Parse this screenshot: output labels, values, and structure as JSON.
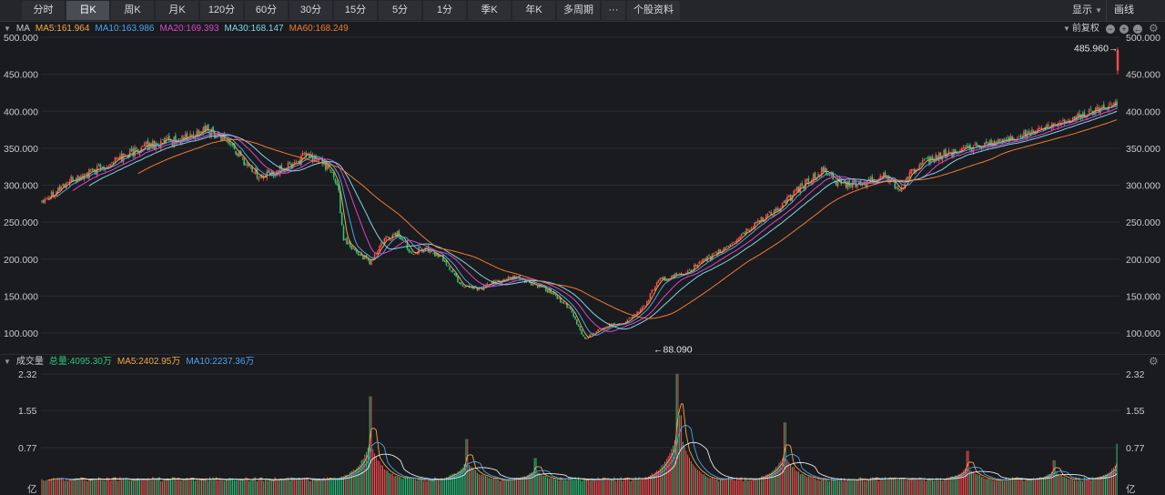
{
  "toolbar": {
    "tabs": [
      {
        "label": "分时",
        "active": false
      },
      {
        "label": "日K",
        "active": true
      },
      {
        "label": "周K",
        "active": false
      },
      {
        "label": "月K",
        "active": false
      },
      {
        "label": "120分",
        "active": false
      },
      {
        "label": "60分",
        "active": false
      },
      {
        "label": "30分",
        "active": false
      },
      {
        "label": "15分",
        "active": false
      },
      {
        "label": "5分",
        "active": false
      },
      {
        "label": "1分",
        "active": false
      },
      {
        "label": "季K",
        "active": false
      },
      {
        "label": "年K",
        "active": false
      },
      {
        "label": "多周期",
        "active": false
      },
      {
        "label": "···",
        "active": false
      },
      {
        "label": "个股资料",
        "active": false
      }
    ],
    "display_label": "显示",
    "draw_label": "画线"
  },
  "price_legend": {
    "indicator": "MA",
    "ma5": "MA5:161.964",
    "ma10": "MA10:163.986",
    "ma20": "MA20:169.393",
    "ma30": "MA30:168.147",
    "ma60": "MA60:168.249",
    "adjust_label": "前复权"
  },
  "volume_legend": {
    "indicator": "成交量",
    "total": "总量:4095.30万",
    "ma5": "MA5:2402.95万",
    "ma10": "MA10:2237.36万"
  },
  "colors": {
    "up": "#ff4d4f",
    "down": "#29c67a",
    "ma5": "#f0a848",
    "ma10": "#4aa3f0",
    "ma20": "#d946c7",
    "ma30": "#7ad6e8",
    "ma60": "#f07a30"
  },
  "chart_data": [
    {
      "type": "candlestick",
      "title": "",
      "ylim": [
        75,
        510
      ],
      "y_ticks": [
        "500.000",
        "450.000",
        "400.000",
        "350.000",
        "300.000",
        "250.000",
        "200.000",
        "150.000",
        "100.000"
      ],
      "trend_points": [
        [
          0,
          280
        ],
        [
          0.03,
          305
        ],
        [
          0.06,
          320
        ],
        [
          0.09,
          340
        ],
        [
          0.12,
          355
        ],
        [
          0.15,
          360
        ],
        [
          0.18,
          375
        ],
        [
          0.2,
          365
        ],
        [
          0.22,
          335
        ],
        [
          0.24,
          310
        ],
        [
          0.27,
          325
        ],
        [
          0.29,
          340
        ],
        [
          0.31,
          330
        ],
        [
          0.325,
          300
        ],
        [
          0.33,
          230
        ],
        [
          0.345,
          210
        ],
        [
          0.36,
          195
        ],
        [
          0.375,
          225
        ],
        [
          0.39,
          235
        ],
        [
          0.405,
          210
        ],
        [
          0.42,
          215
        ],
        [
          0.44,
          200
        ],
        [
          0.46,
          165
        ],
        [
          0.48,
          160
        ],
        [
          0.5,
          170
        ],
        [
          0.52,
          175
        ],
        [
          0.54,
          165
        ],
        [
          0.56,
          155
        ],
        [
          0.58,
          130
        ],
        [
          0.595,
          92
        ],
        [
          0.605,
          100
        ],
        [
          0.62,
          110
        ],
        [
          0.64,
          115
        ],
        [
          0.66,
          135
        ],
        [
          0.675,
          170
        ],
        [
          0.69,
          175
        ],
        [
          0.71,
          185
        ],
        [
          0.73,
          200
        ],
        [
          0.75,
          215
        ],
        [
          0.77,
          235
        ],
        [
          0.79,
          255
        ],
        [
          0.81,
          270
        ],
        [
          0.83,
          295
        ],
        [
          0.85,
          315
        ],
        [
          0.86,
          320
        ],
        [
          0.875,
          300
        ],
        [
          0.89,
          300
        ],
        [
          0.91,
          305
        ],
        [
          0.925,
          315
        ],
        [
          0.94,
          295
        ],
        [
          0.955,
          320
        ],
        [
          0.97,
          330
        ],
        [
          0.985,
          340
        ],
        [
          1.0,
          345
        ]
      ],
      "tail_points": [
        [
          0,
          345
        ],
        [
          0.3,
          360
        ],
        [
          0.6,
          380
        ],
        [
          0.85,
          400
        ],
        [
          1.0,
          412
        ]
      ],
      "last_candle": {
        "open": 455,
        "close": 483,
        "high": 486,
        "low": 450
      },
      "max_annotation": "485.960→",
      "min_annotation": "←88.090",
      "max_value": 485.96,
      "min_value": 88.09
    },
    {
      "type": "bar",
      "title": "",
      "ylim": [
        0,
        2.32
      ],
      "y_ticks": [
        "2.32",
        "1.55",
        "0.77"
      ],
      "unit_label": "亿",
      "spikes": [
        {
          "x": 0.305,
          "v": 1.85
        },
        {
          "x": 0.395,
          "v": 0.95
        },
        {
          "x": 0.458,
          "v": 0.55
        },
        {
          "x": 0.59,
          "v": 2.32
        },
        {
          "x": 0.593,
          "v": 1.45
        },
        {
          "x": 0.69,
          "v": 1.3
        },
        {
          "x": 0.86,
          "v": 0.7
        },
        {
          "x": 0.94,
          "v": 0.5
        },
        {
          "x": 0.999,
          "v": 0.85
        }
      ]
    }
  ]
}
